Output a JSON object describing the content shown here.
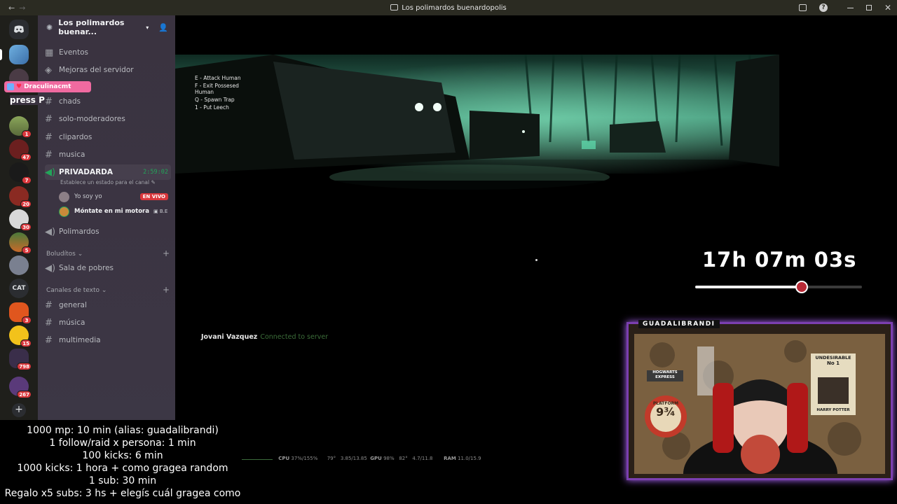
{
  "window": {
    "title": "Los polimardos buenardopolis",
    "nav_back": "←",
    "nav_forward": "→"
  },
  "rail": {
    "cat_label": "CAT",
    "badges": [
      "1",
      "47",
      "7",
      "20",
      "30",
      "5",
      "3",
      "15",
      "798",
      "267"
    ]
  },
  "sidebar": {
    "server_name": "Los polimardos buenar...",
    "overlay_press": "press P",
    "overlay_name": "Draculinacmt",
    "items": [
      {
        "icon": "calendar-icon",
        "label": "Eventos"
      },
      {
        "icon": "boost-icon",
        "label": "Mejoras del servidor"
      },
      {
        "icon": "hash-icon",
        "label": "chads"
      },
      {
        "icon": "hash-icon",
        "label": "solo-moderadores"
      },
      {
        "icon": "hash-icon",
        "label": "clipardos"
      },
      {
        "icon": "hash-icon",
        "label": "musica"
      }
    ],
    "voice": {
      "name": "PRIVADARDA",
      "time": "2:59:02",
      "status": "Establece un estado para el canal",
      "users": [
        {
          "name": "Yo soy yo",
          "badge": "EN VIVO"
        },
        {
          "name": "Móntate en mi motora",
          "tag": "B.E"
        }
      ]
    },
    "polimardos": "Polimardos",
    "categories": [
      {
        "name": "Boludítos",
        "channels": [
          {
            "icon": "speaker-icon",
            "label": "Sala de pobres"
          }
        ]
      },
      {
        "name": "Canales de texto",
        "channels": [
          {
            "icon": "hash-icon",
            "label": "general"
          },
          {
            "icon": "hash-icon",
            "label": "música"
          },
          {
            "icon": "hash-icon",
            "label": "multimedia"
          }
        ]
      }
    ]
  },
  "game": {
    "hints": [
      "E - Attack Human",
      "F - Exit Possesed",
      "Human",
      "Q - Spawn Trap",
      "1 - Put Leech"
    ],
    "connected_user": "Jovani Vazquez",
    "connected_msg": "Connected to server",
    "timer": "17h 07m 03s",
    "timer_progress": 0.64,
    "perf": {
      "cpu": "CPU",
      "cpu_val": "37%/155%",
      "temp": "79°",
      "clock": "3.85/13.85",
      "gpu": "GPU",
      "gpu_val": "98%",
      "gpu_temp": "82°",
      "vram": "4.7/11.8",
      "ram": "RAM",
      "ram_val": "11.0/15.9"
    }
  },
  "cam": {
    "label": "GUADALIBRANDI",
    "sign_platform": "PLATFORM",
    "sign_number": "9¾",
    "sign_hogwarts": "HOGWARTS EXPRESS",
    "poster_title": "UNDESIRABLE",
    "poster_no": "No 1",
    "poster_name": "HARRY POTTER"
  },
  "rules": [
    "1000 mp: 10 min (alias: guadalibrandi)",
    "1 follow/raid x persona: 1 min",
    "100 kicks: 6 min",
    "1000 kicks: 1 hora + como gragea random",
    "1 sub: 30 min",
    "Regalo x5 subs: 3 hs + elegís cuál gragea como"
  ],
  "colors": {
    "accent_live": "#da373c",
    "voice_green": "#23a55a",
    "cam_border": "#7b3fb0"
  }
}
